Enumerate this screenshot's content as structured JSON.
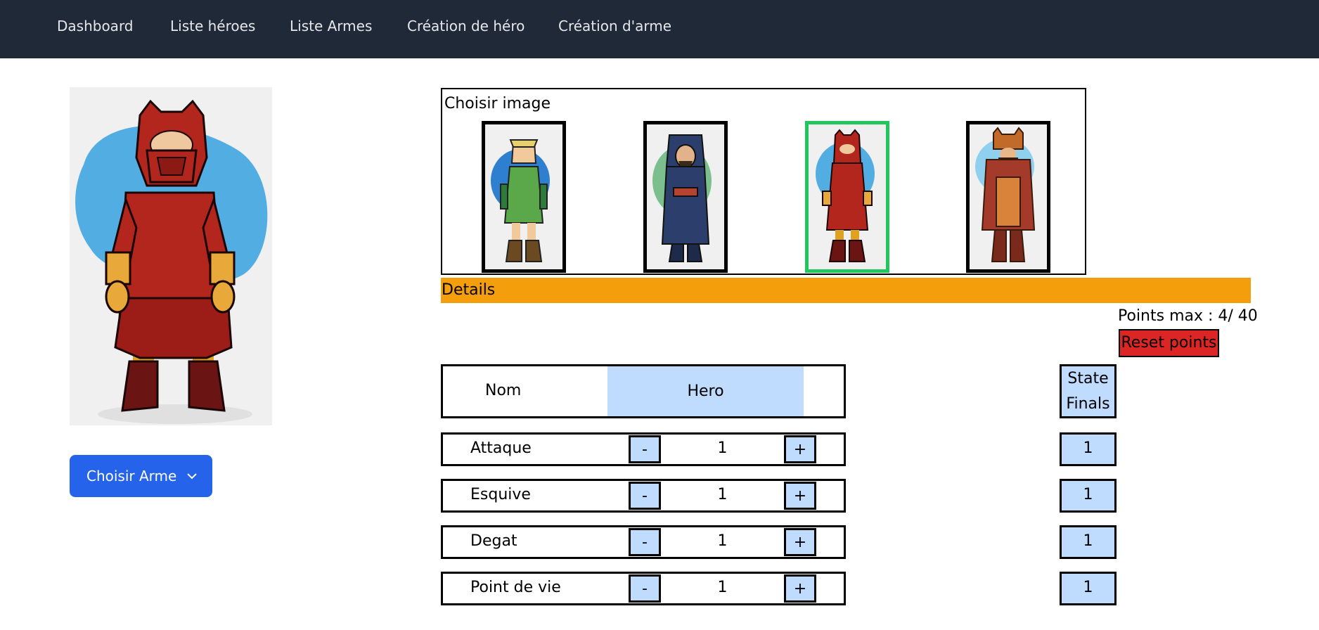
{
  "nav": {
    "items": [
      {
        "label": "Dashboard"
      },
      {
        "label": "Liste héroes"
      },
      {
        "label": "Liste Armes"
      },
      {
        "label": "Création de héro"
      },
      {
        "label": "Création d'arme"
      }
    ]
  },
  "weapon_dropdown": {
    "label": "Choisir Arme",
    "icon": "chevron-down-icon"
  },
  "image_chooser": {
    "title": "Choisir image",
    "options": [
      {
        "name": "elf-archer",
        "selected": false
      },
      {
        "name": "hooded-rogue",
        "selected": false
      },
      {
        "name": "red-owl-knight",
        "selected": true
      },
      {
        "name": "dwarf-warrior",
        "selected": false
      }
    ]
  },
  "details": {
    "title": "Details",
    "points_max_text": "Points max : 4/ 40",
    "reset_label": "Reset points"
  },
  "form": {
    "name_label": "Nom",
    "name_value": "Hero",
    "stats": [
      {
        "label": "Attaque",
        "value": "1"
      },
      {
        "label": "Esquive",
        "value": "1"
      },
      {
        "label": "Degat",
        "value": "1"
      },
      {
        "label": "Point de vie",
        "value": "1"
      }
    ],
    "minus": "-",
    "plus": "+"
  },
  "final": {
    "header_line1": "State",
    "header_line2": "Finals",
    "values": [
      "1",
      "1",
      "1",
      "1"
    ]
  },
  "colors": {
    "navbar": "#1f2937",
    "primary": "#2563eb",
    "details_bar": "#f59e0b",
    "reset": "#dc2626",
    "light_blue": "#bfdbfe",
    "selected_border": "#22c55e"
  }
}
